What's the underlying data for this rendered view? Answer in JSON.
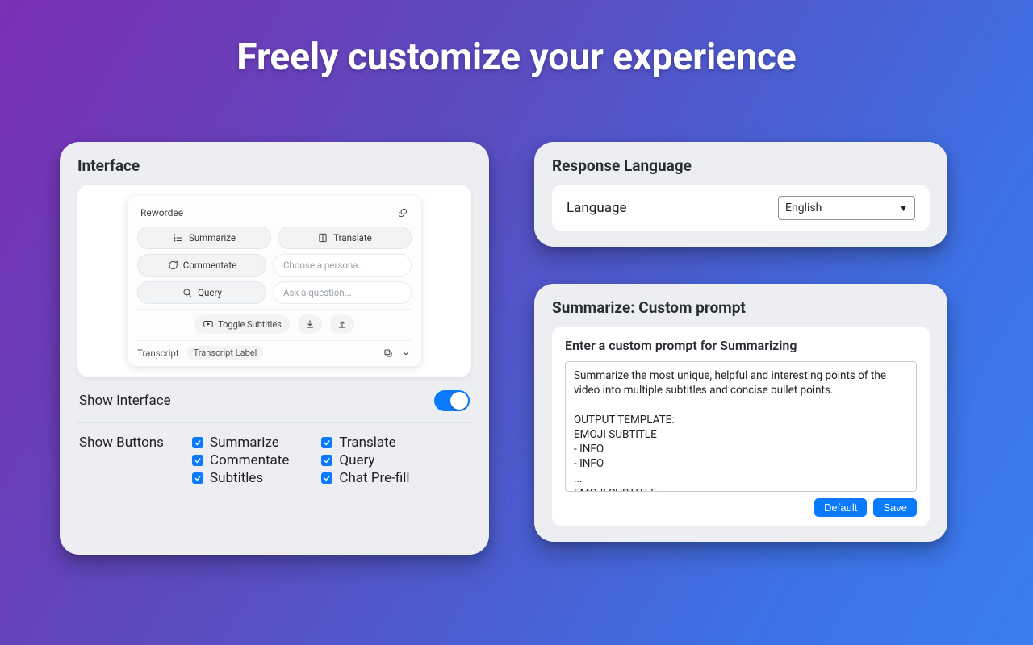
{
  "title": "Freely customize your experience",
  "interface": {
    "heading": "Interface",
    "preview": {
      "app_name": "Rewordee",
      "summarize": "Summarize",
      "translate": "Translate",
      "commentate": "Commentate",
      "persona_placeholder": "Choose a persona...",
      "query": "Query",
      "ask_placeholder": "Ask a question...",
      "toggle_subs": "Toggle Subtitles",
      "transcript": "Transcript",
      "transcript_label": "Transcript Label"
    },
    "show_interface_label": "Show Interface",
    "show_buttons_label": "Show Buttons",
    "buttons": {
      "summarize": "Summarize",
      "translate": "Translate",
      "commentate": "Commentate",
      "query": "Query",
      "subtitles": "Subtitles",
      "chat_prefill": "Chat Pre-fill"
    }
  },
  "language_panel": {
    "heading": "Response Language",
    "label": "Language",
    "value": "English"
  },
  "summarize_panel": {
    "heading": "Summarize: Custom prompt",
    "subtitle": "Enter a custom prompt for Summarizing",
    "prompt": "Summarize the most unique, helpful and interesting points of the video into multiple subtitles and concise bullet points.\n\nOUTPUT TEMPLATE:\nEMOJI SUBTITLE\n- INFO\n- INFO\n...\nEMOJI SUBTITLE\n- INFO\n- INFO",
    "default_btn": "Default",
    "save_btn": "Save"
  }
}
